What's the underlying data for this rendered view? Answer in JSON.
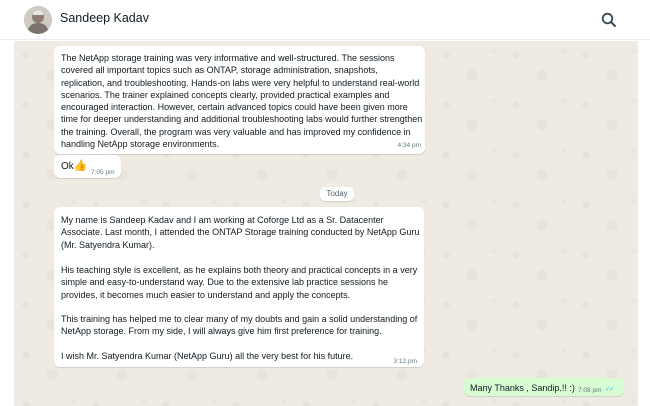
{
  "header": {
    "contact_name": "Sandeep Kadav"
  },
  "messages": [
    {
      "direction": "incoming",
      "text": "The NetApp storage training was very informative and well-structured. The sessions covered all important topics such as ONTAP, storage administration, snapshots, replication, and troubleshooting. Hands-on labs were very helpful to understand real-world scenarios. The trainer explained concepts clearly, provided practical examples and encouraged interaction. However, certain advanced topics could have been given more time for deeper understanding and additional troubleshooting labs would further strengthen the training. Overall, the program was very valuable and has improved my confidence in handling NetApp storage environments.",
      "time": "4:34 pm"
    },
    {
      "direction": "incoming",
      "text": "Ok",
      "emoji": "👍",
      "time": "7:05 pm"
    },
    {
      "direction": "incoming",
      "paragraphs": [
        "My name is Sandeep Kadav and I am working at Coforge Ltd as a Sr. Datacenter Associate. Last month, I attended the ONTAP Storage training conducted by NetApp Guru (Mr. Satyendra Kumar).",
        "His teaching style is excellent, as he explains both theory and practical concepts in a very simple and easy-to-understand way. Due to the extensive lab practice sessions he provides, it becomes much easier to understand and apply the concepts.",
        "This training has helped me to clear many of my doubts and gain a solid understanding of NetApp storage. From my side, I will always give him first preference for training.",
        "I wish Mr. Satyendra Kumar (NetApp Guru) all the very best for his future."
      ],
      "time": "3:12 pm"
    },
    {
      "direction": "outgoing",
      "text": "Many Thanks , Sandip.!! :)",
      "time": "7:08 pm",
      "status": "read"
    }
  ],
  "date_separator": "Today",
  "icons": {
    "search": "search-icon",
    "read_receipt": "double-check-icon",
    "avatar": "avatar"
  },
  "colors": {
    "chat_background": "#efeae2",
    "incoming_bubble": "#ffffff",
    "outgoing_bubble": "#d9fdd3",
    "read_tick": "#53bdeb"
  }
}
